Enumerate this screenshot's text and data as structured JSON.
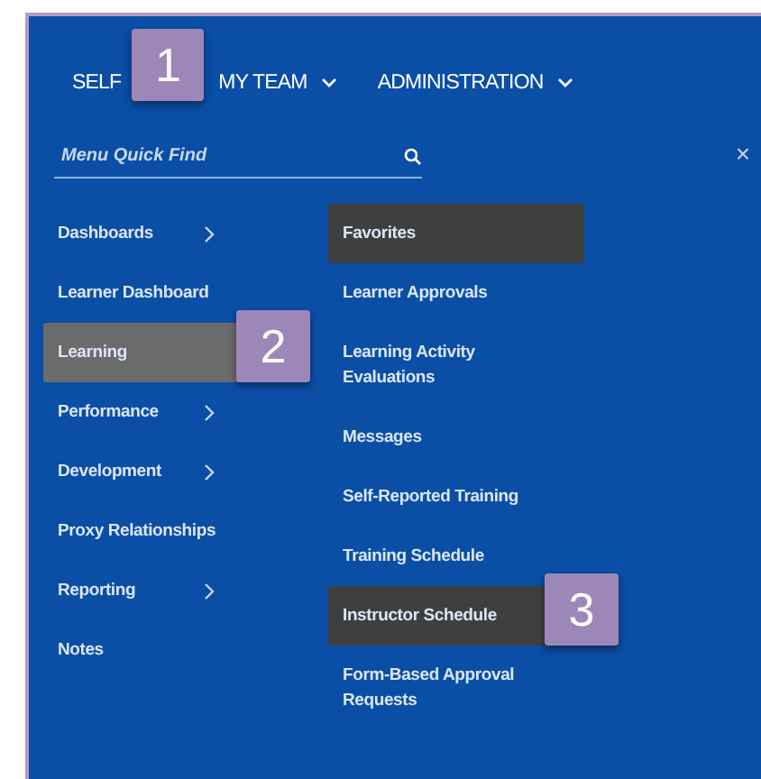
{
  "nav": [
    {
      "label": "SELF",
      "dropdown": false,
      "callout": "1"
    },
    {
      "label": "MY TEAM",
      "dropdown": true
    },
    {
      "label": "ADMINISTRATION",
      "dropdown": true
    }
  ],
  "search": {
    "placeholder": "Menu Quick Find"
  },
  "close": "×",
  "menu": [
    {
      "label": "Dashboards",
      "has_children": true,
      "selected": false
    },
    {
      "label": "Learner Dashboard",
      "has_children": false,
      "selected": false
    },
    {
      "label": "Learning",
      "has_children": false,
      "selected": true,
      "callout": "2"
    },
    {
      "label": "Performance",
      "has_children": true,
      "selected": false
    },
    {
      "label": "Development",
      "has_children": true,
      "selected": false
    },
    {
      "label": "Proxy Relationships",
      "has_children": false,
      "selected": false
    },
    {
      "label": "Reporting",
      "has_children": true,
      "selected": false
    },
    {
      "label": "Notes",
      "has_children": false,
      "selected": false
    }
  ],
  "submenu": [
    {
      "label": "Favorites",
      "selected": true
    },
    {
      "label": "Learner Approvals",
      "selected": false
    },
    {
      "label": "Learning Activity Evaluations",
      "selected": false
    },
    {
      "label": "Messages",
      "selected": false
    },
    {
      "label": "Self-Reported Training",
      "selected": false
    },
    {
      "label": "Training Schedule",
      "selected": false
    },
    {
      "label": "Instructor Schedule",
      "selected": true,
      "callout": "3"
    },
    {
      "label": "Form-Based Approval Requests",
      "selected": false
    }
  ]
}
